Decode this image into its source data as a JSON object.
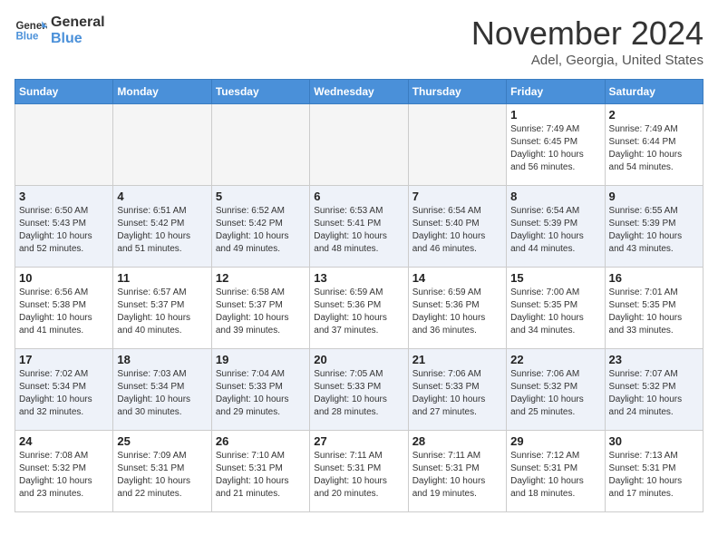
{
  "header": {
    "logo_line1": "General",
    "logo_line2": "Blue",
    "month": "November 2024",
    "location": "Adel, Georgia, United States"
  },
  "weekdays": [
    "Sunday",
    "Monday",
    "Tuesday",
    "Wednesday",
    "Thursday",
    "Friday",
    "Saturday"
  ],
  "weeks": [
    [
      {
        "day": "",
        "info": ""
      },
      {
        "day": "",
        "info": ""
      },
      {
        "day": "",
        "info": ""
      },
      {
        "day": "",
        "info": ""
      },
      {
        "day": "",
        "info": ""
      },
      {
        "day": "1",
        "info": "Sunrise: 7:49 AM\nSunset: 6:45 PM\nDaylight: 10 hours and 56 minutes."
      },
      {
        "day": "2",
        "info": "Sunrise: 7:49 AM\nSunset: 6:44 PM\nDaylight: 10 hours and 54 minutes."
      }
    ],
    [
      {
        "day": "3",
        "info": "Sunrise: 6:50 AM\nSunset: 5:43 PM\nDaylight: 10 hours and 52 minutes."
      },
      {
        "day": "4",
        "info": "Sunrise: 6:51 AM\nSunset: 5:42 PM\nDaylight: 10 hours and 51 minutes."
      },
      {
        "day": "5",
        "info": "Sunrise: 6:52 AM\nSunset: 5:42 PM\nDaylight: 10 hours and 49 minutes."
      },
      {
        "day": "6",
        "info": "Sunrise: 6:53 AM\nSunset: 5:41 PM\nDaylight: 10 hours and 48 minutes."
      },
      {
        "day": "7",
        "info": "Sunrise: 6:54 AM\nSunset: 5:40 PM\nDaylight: 10 hours and 46 minutes."
      },
      {
        "day": "8",
        "info": "Sunrise: 6:54 AM\nSunset: 5:39 PM\nDaylight: 10 hours and 44 minutes."
      },
      {
        "day": "9",
        "info": "Sunrise: 6:55 AM\nSunset: 5:39 PM\nDaylight: 10 hours and 43 minutes."
      }
    ],
    [
      {
        "day": "10",
        "info": "Sunrise: 6:56 AM\nSunset: 5:38 PM\nDaylight: 10 hours and 41 minutes."
      },
      {
        "day": "11",
        "info": "Sunrise: 6:57 AM\nSunset: 5:37 PM\nDaylight: 10 hours and 40 minutes."
      },
      {
        "day": "12",
        "info": "Sunrise: 6:58 AM\nSunset: 5:37 PM\nDaylight: 10 hours and 39 minutes."
      },
      {
        "day": "13",
        "info": "Sunrise: 6:59 AM\nSunset: 5:36 PM\nDaylight: 10 hours and 37 minutes."
      },
      {
        "day": "14",
        "info": "Sunrise: 6:59 AM\nSunset: 5:36 PM\nDaylight: 10 hours and 36 minutes."
      },
      {
        "day": "15",
        "info": "Sunrise: 7:00 AM\nSunset: 5:35 PM\nDaylight: 10 hours and 34 minutes."
      },
      {
        "day": "16",
        "info": "Sunrise: 7:01 AM\nSunset: 5:35 PM\nDaylight: 10 hours and 33 minutes."
      }
    ],
    [
      {
        "day": "17",
        "info": "Sunrise: 7:02 AM\nSunset: 5:34 PM\nDaylight: 10 hours and 32 minutes."
      },
      {
        "day": "18",
        "info": "Sunrise: 7:03 AM\nSunset: 5:34 PM\nDaylight: 10 hours and 30 minutes."
      },
      {
        "day": "19",
        "info": "Sunrise: 7:04 AM\nSunset: 5:33 PM\nDaylight: 10 hours and 29 minutes."
      },
      {
        "day": "20",
        "info": "Sunrise: 7:05 AM\nSunset: 5:33 PM\nDaylight: 10 hours and 28 minutes."
      },
      {
        "day": "21",
        "info": "Sunrise: 7:06 AM\nSunset: 5:33 PM\nDaylight: 10 hours and 27 minutes."
      },
      {
        "day": "22",
        "info": "Sunrise: 7:06 AM\nSunset: 5:32 PM\nDaylight: 10 hours and 25 minutes."
      },
      {
        "day": "23",
        "info": "Sunrise: 7:07 AM\nSunset: 5:32 PM\nDaylight: 10 hours and 24 minutes."
      }
    ],
    [
      {
        "day": "24",
        "info": "Sunrise: 7:08 AM\nSunset: 5:32 PM\nDaylight: 10 hours and 23 minutes."
      },
      {
        "day": "25",
        "info": "Sunrise: 7:09 AM\nSunset: 5:31 PM\nDaylight: 10 hours and 22 minutes."
      },
      {
        "day": "26",
        "info": "Sunrise: 7:10 AM\nSunset: 5:31 PM\nDaylight: 10 hours and 21 minutes."
      },
      {
        "day": "27",
        "info": "Sunrise: 7:11 AM\nSunset: 5:31 PM\nDaylight: 10 hours and 20 minutes."
      },
      {
        "day": "28",
        "info": "Sunrise: 7:11 AM\nSunset: 5:31 PM\nDaylight: 10 hours and 19 minutes."
      },
      {
        "day": "29",
        "info": "Sunrise: 7:12 AM\nSunset: 5:31 PM\nDaylight: 10 hours and 18 minutes."
      },
      {
        "day": "30",
        "info": "Sunrise: 7:13 AM\nSunset: 5:31 PM\nDaylight: 10 hours and 17 minutes."
      }
    ]
  ]
}
